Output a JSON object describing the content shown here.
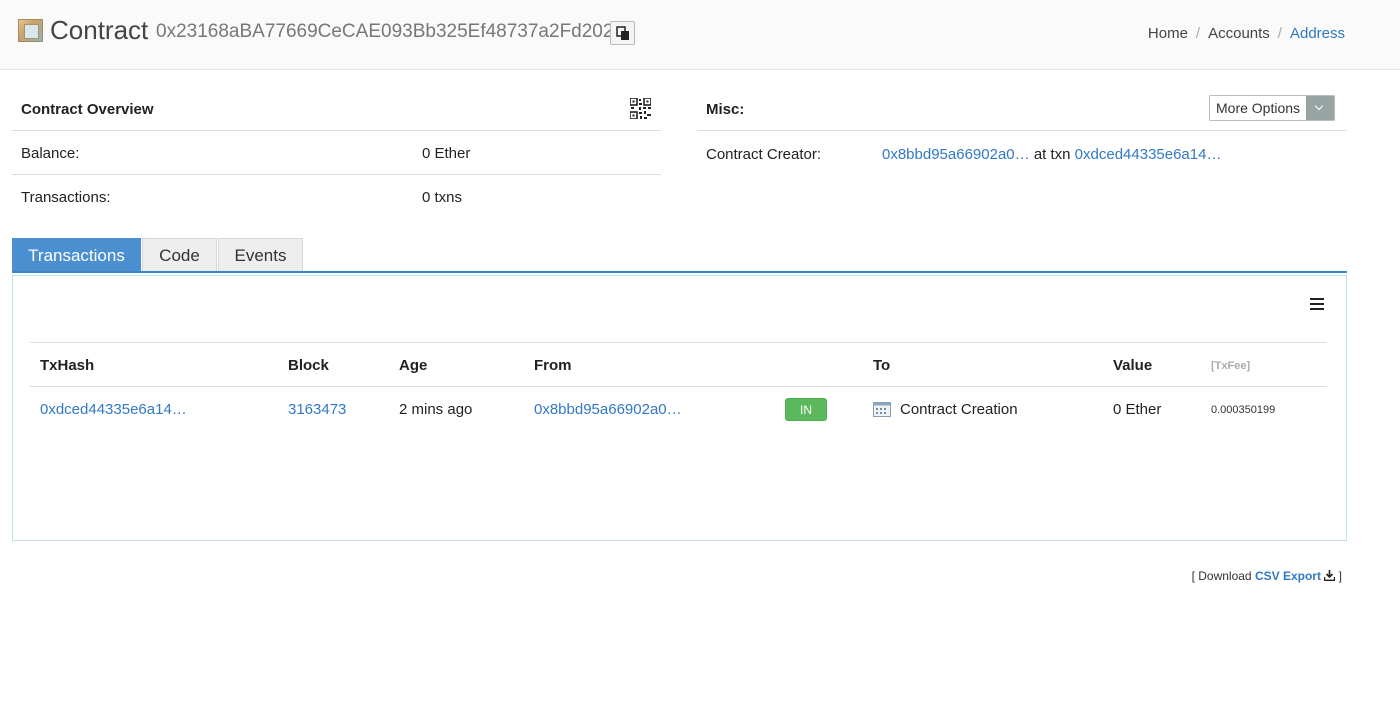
{
  "header": {
    "title": "Contract",
    "address": "0x23168aBA77669CeCAE093Bb325Ef48737a2Fd202",
    "breadcrumb": [
      "Home",
      "Accounts",
      "Address"
    ]
  },
  "overview": {
    "title": "Contract Overview",
    "balance_label": "Balance:",
    "balance_value": "0 Ether",
    "transactions_label": "Transactions:",
    "transactions_value": "0 txns"
  },
  "misc": {
    "title": "Misc:",
    "more_options_label": "More Options",
    "creator_label": "Contract Creator:",
    "creator_address": "0x8bbd95a66902a0…",
    "at_txn_text": "at txn",
    "creator_txn": "0xdced44335e6a14…"
  },
  "tabs": [
    {
      "label": "Transactions",
      "active": true
    },
    {
      "label": "Code",
      "active": false
    },
    {
      "label": "Events",
      "active": false
    }
  ],
  "table": {
    "columns": [
      "TxHash",
      "Block",
      "Age",
      "From",
      "To",
      "Value",
      "[TxFee]"
    ],
    "rows": [
      {
        "txhash": "0xdced44335e6a14…",
        "block": "3163473",
        "age": "2 mins ago",
        "from": "0x8bbd95a66902a0…",
        "direction": "IN",
        "to": "Contract Creation",
        "value": "0 Ether",
        "txfee": "0.000350199"
      }
    ]
  },
  "csv": {
    "prefix": "[ Download",
    "link": "CSV Export",
    "suffix": "]"
  },
  "colors": {
    "link": "#3178c6",
    "tab_active": "#4a8fd0",
    "badge_in": "#5cb85c"
  },
  "icons": [
    "contract-logo-icon",
    "copy-icon",
    "qr-code-icon",
    "chevron-down-icon",
    "hamburger-menu-icon",
    "contract-creation-icon",
    "download-icon"
  ]
}
